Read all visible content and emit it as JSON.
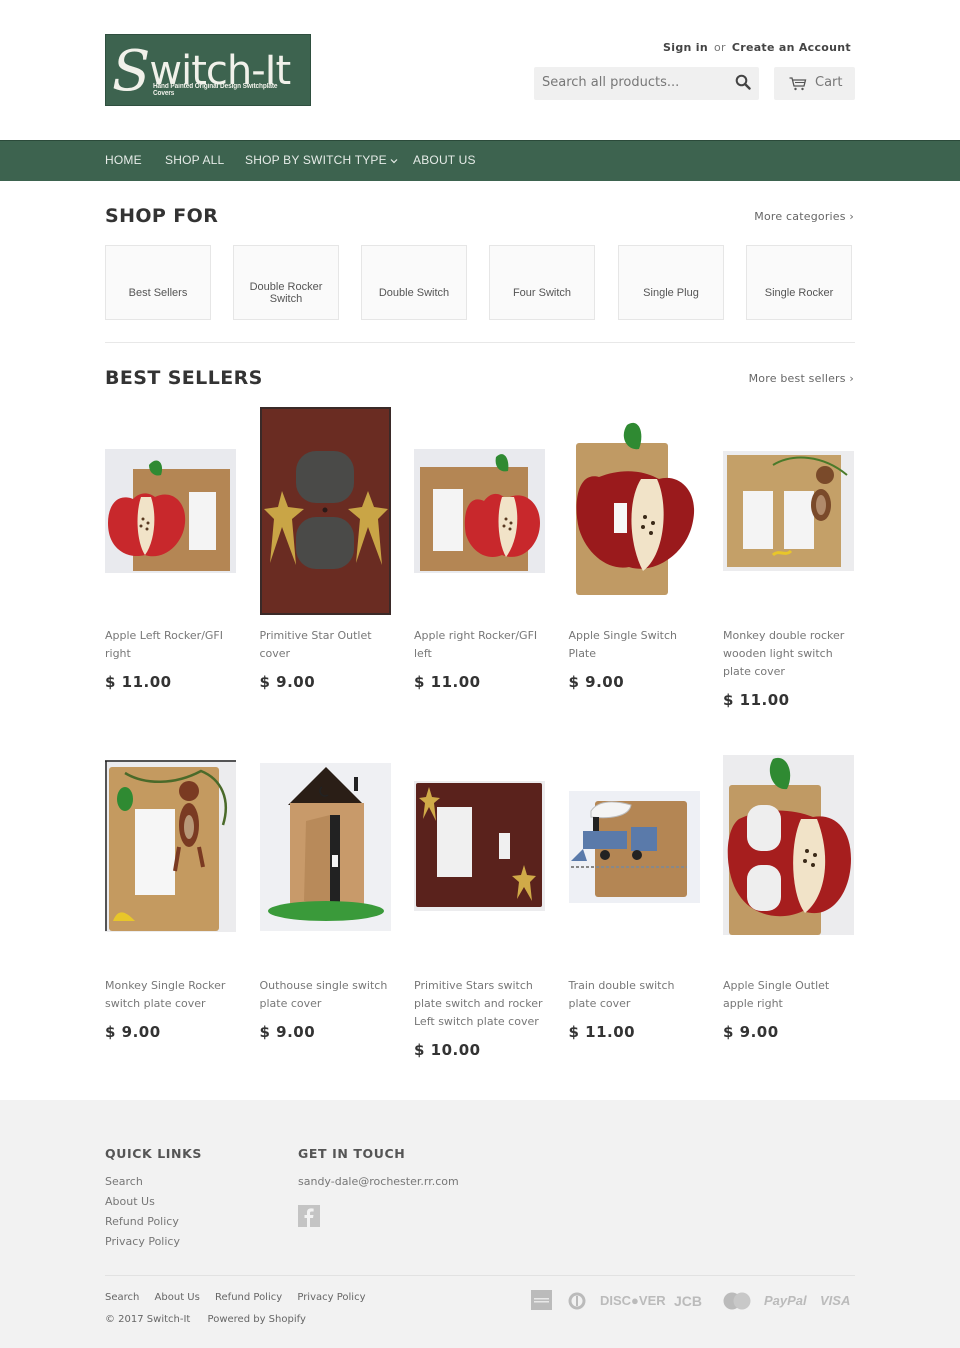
{
  "brand": {
    "logo_title": "witch-It",
    "logo_initial": "S",
    "logo_tagline": "Hand Painted Original Design Switchplate Covers",
    "primary_color": "#3d634f"
  },
  "header": {
    "sign_in": "Sign in",
    "or": "or",
    "create_account": "Create an Account",
    "search_placeholder": "Search all products...",
    "cart_label": "Cart"
  },
  "nav": {
    "items": [
      {
        "label": "HOME"
      },
      {
        "label": "SHOP ALL"
      },
      {
        "label": "SHOP BY SWITCH TYPE",
        "has_dropdown": true
      },
      {
        "label": "ABOUT US"
      }
    ]
  },
  "shop_for": {
    "title": "SHOP FOR",
    "more_link": "More categories ›",
    "categories": [
      {
        "label": "Best Sellers"
      },
      {
        "label": "Double Rocker Switch"
      },
      {
        "label": "Double Switch"
      },
      {
        "label": "Four Switch"
      },
      {
        "label": "Single Plug"
      },
      {
        "label": "Single Rocker"
      }
    ]
  },
  "best_sellers": {
    "title": "BEST SELLERS",
    "more_link": "More best sellers ›",
    "products": [
      {
        "title": "Apple Left Rocker/GFI right",
        "price": "$ 11.00"
      },
      {
        "title": "Primitive Star Outlet cover",
        "price": "$ 9.00"
      },
      {
        "title": "Apple right Rocker/GFI left",
        "price": "$ 11.00"
      },
      {
        "title": "Apple Single Switch Plate",
        "price": "$ 9.00"
      },
      {
        "title": "Monkey double rocker wooden light switch plate cover",
        "price": "$ 11.00"
      },
      {
        "title": "Monkey Single Rocker switch plate cover",
        "price": "$ 9.00"
      },
      {
        "title": "Outhouse single switch plate cover",
        "price": "$ 9.00"
      },
      {
        "title": "Primitive Stars switch plate switch and rocker Left switch plate cover",
        "price": "$ 10.00"
      },
      {
        "title": "Train double switch plate cover",
        "price": "$ 11.00"
      },
      {
        "title": "Apple Single Outlet apple right",
        "price": "$ 9.00"
      }
    ]
  },
  "footer": {
    "quick_links_title": "QUICK LINKS",
    "quick_links": [
      "Search",
      "About Us",
      "Refund Policy",
      "Privacy Policy"
    ],
    "get_in_touch_title": "GET IN TOUCH",
    "email": "sandy-dale@rochester.rr.com",
    "bottom_links": [
      "Search",
      "About Us",
      "Refund Policy",
      "Privacy Policy"
    ],
    "copyright": "© 2017 Switch-It",
    "powered_by": "Powered by Shopify",
    "payment_methods": [
      "American Express",
      "Diners Club",
      "DISCOVER",
      "JCB",
      "MasterCard",
      "PayPal",
      "VISA"
    ],
    "payment_labels": {
      "discover": "DISC●VER",
      "jcb": "JCB",
      "paypal": "PayPal",
      "visa": "VISA"
    }
  }
}
